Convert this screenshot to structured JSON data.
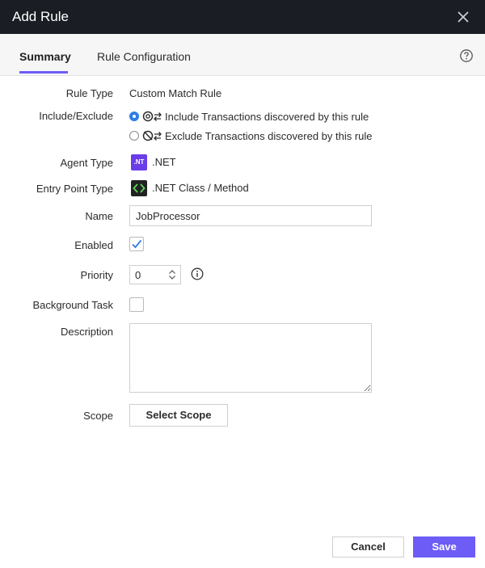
{
  "dialog": {
    "title": "Add Rule"
  },
  "tabs": [
    {
      "label": "Summary",
      "active": true
    },
    {
      "label": "Rule Configuration",
      "active": false
    }
  ],
  "form": {
    "rule_type": {
      "label": "Rule Type",
      "value": "Custom Match Rule"
    },
    "include_exclude": {
      "label": "Include/Exclude",
      "options": [
        {
          "label": "Include Transactions discovered by this rule",
          "selected": true
        },
        {
          "label": "Exclude Transactions discovered by this rule",
          "selected": false
        }
      ]
    },
    "agent_type": {
      "label": "Agent Type",
      "value": ".NET",
      "badge": ".NT"
    },
    "entry_point_type": {
      "label": "Entry Point Type",
      "value": ".NET Class / Method"
    },
    "name": {
      "label": "Name",
      "value": "JobProcessor"
    },
    "enabled": {
      "label": "Enabled",
      "checked": true
    },
    "priority": {
      "label": "Priority",
      "value": "0"
    },
    "background_task": {
      "label": "Background Task",
      "checked": false
    },
    "description": {
      "label": "Description",
      "value": ""
    },
    "scope": {
      "label": "Scope",
      "button_label": "Select Scope"
    }
  },
  "footer": {
    "cancel_label": "Cancel",
    "save_label": "Save"
  },
  "colors": {
    "accent": "#6d5cf6",
    "titlebar": "#1a1d24",
    "radio": "#2f7de8",
    "check": "#2f7de8"
  }
}
